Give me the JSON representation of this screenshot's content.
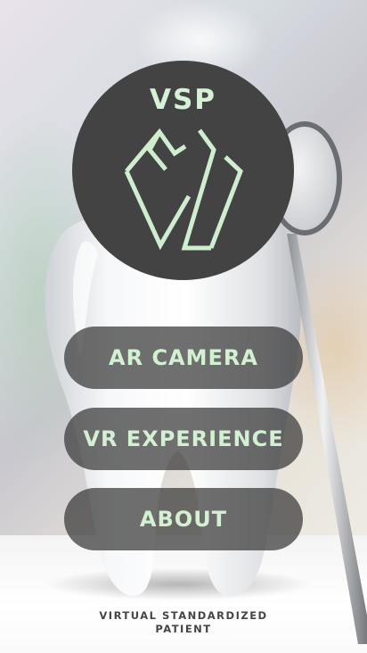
{
  "app": {
    "title": "VSP",
    "subtitle": "VIRTUAL STANDARDIZED PATIENT"
  },
  "menu": {
    "ar_camera_label": "AR CAMERA",
    "vr_experience_label": "VR EXPERIENCE",
    "about_label": "ABOUT"
  },
  "colors": {
    "accent_text": "#d3f0d3",
    "logo_circle": "#434343",
    "button_bg": "#373737"
  },
  "icons": {
    "logo": "tooth-logo-icon",
    "background": "tooth-and-dental-mirror-image"
  }
}
